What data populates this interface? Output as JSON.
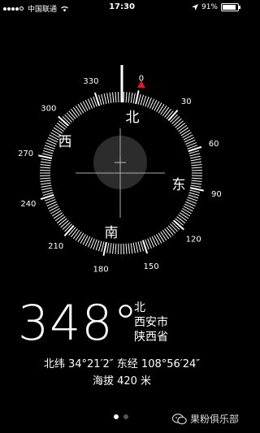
{
  "status_bar": {
    "carrier": "中国联通",
    "time": "17:30",
    "battery": "91%",
    "battery_level": 0.91,
    "signal_bars": 4
  },
  "compass": {
    "heading_deg": 348,
    "degree_labels": [
      "0",
      "30",
      "60",
      "90",
      "120",
      "150",
      "180",
      "210",
      "240",
      "270",
      "300",
      "330"
    ],
    "cardinals": {
      "north": "北",
      "east": "东",
      "south": "南",
      "west": "西"
    },
    "target_color": "#e5171c"
  },
  "reading": {
    "heading_text": "348°",
    "direction": "北",
    "city": "西安市",
    "province": "陕西省",
    "coordinates": "北纬 34°21′2″  东经 108°56′24″",
    "altitude": "海拔 420 米"
  },
  "pager": {
    "pages": 2,
    "active": 0
  },
  "watermark": {
    "text": "果粉俱乐部",
    "icon": "wechat-icon"
  }
}
